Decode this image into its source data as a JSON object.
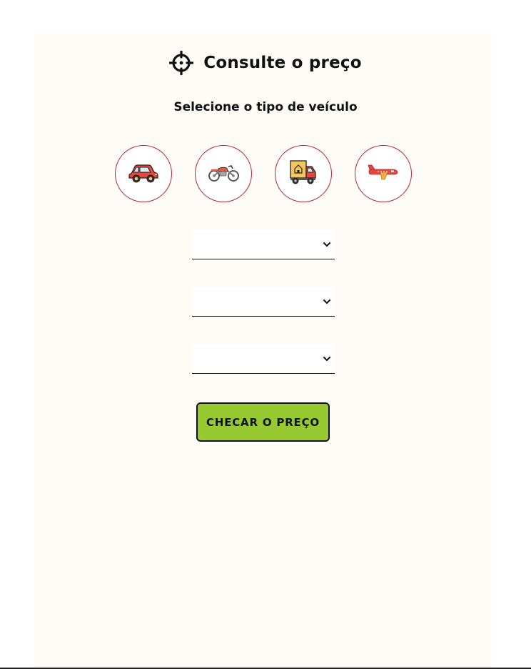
{
  "header": {
    "title": "Consulte o preço",
    "icon": "crosshair-icon"
  },
  "vehicle_section": {
    "heading": "Selecione o tipo de veículo",
    "options": [
      {
        "name": "car",
        "icon": "car-icon"
      },
      {
        "name": "motorcycle",
        "icon": "motorcycle-icon"
      },
      {
        "name": "truck",
        "icon": "truck-icon"
      },
      {
        "name": "airplane",
        "icon": "airplane-icon"
      }
    ]
  },
  "selects": [
    {
      "value": ""
    },
    {
      "value": ""
    },
    {
      "value": ""
    }
  ],
  "actions": {
    "check_price_label": "CHECAR O PREÇO"
  },
  "colors": {
    "panel_background": "#fffbf6",
    "circle_border": "#b52a2a",
    "button_background": "#97c930"
  }
}
